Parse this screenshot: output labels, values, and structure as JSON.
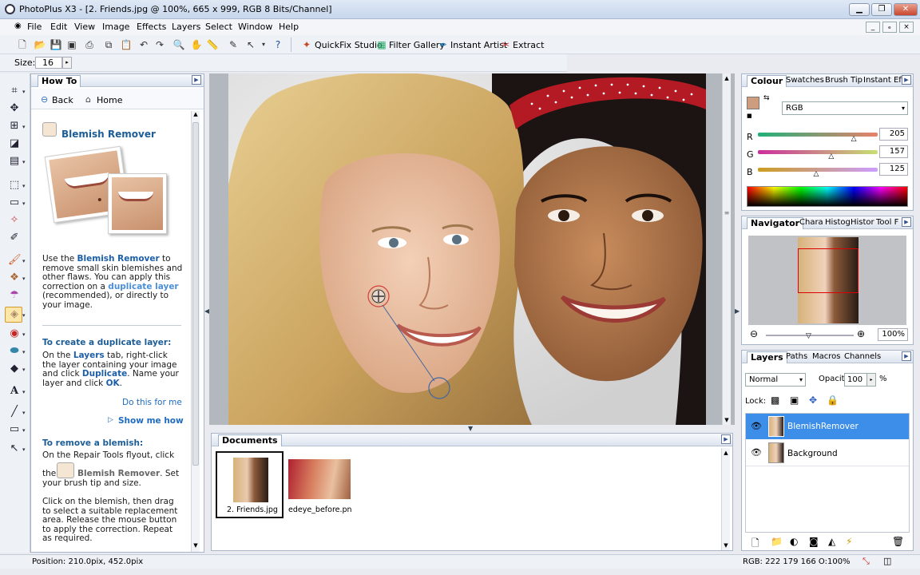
{
  "window": {
    "title": "PhotoPlus X3 - [2. Friends.jpg @ 100%, 665 x 999, RGB 8 Bits/Channel]",
    "controls": [
      "minimize",
      "maximize",
      "close"
    ],
    "mdi_controls": [
      "_",
      "ₑ",
      "×"
    ]
  },
  "menu": [
    "File",
    "Edit",
    "View",
    "Image",
    "Effects",
    "Layers",
    "Select",
    "Window",
    "Help"
  ],
  "toolbar": {
    "quickfix": "QuickFix Studio",
    "filter_gallery": "Filter Gallery",
    "instant_artist": "Instant Artist",
    "extract": "Extract"
  },
  "context": {
    "size_label": "Size:",
    "size_value": "16"
  },
  "howto": {
    "tab": "How To",
    "back": "Back",
    "home": "Home",
    "title": "Blemish Remover",
    "intro_pre": "Use the ",
    "intro_tool": "Blemish Remover",
    "intro_mid": " to remove small skin blemishes and other flaws. You can apply this correction on a ",
    "intro_link": "duplicate layer",
    "intro_post": " (recommended), or directly to your image.",
    "section1": "To create a duplicate layer:",
    "s1_pre": "On the ",
    "s1_layers": "Layers",
    "s1_mid": " tab, right-click the layer containing your image and click ",
    "s1_dup": "Duplicate",
    "s1_mid2": ". Name your layer and click ",
    "s1_ok": "OK",
    "s1_end": ".",
    "do_this": "Do this for me",
    "show_me": "Show me how",
    "section2": "To remove a blemish:",
    "s2_line1": "On the Repair Tools flyout, click",
    "s2_the": "the",
    "s2_tool": "Blemish Remover",
    "s2_rest": ". Set your brush tip and size.",
    "s2_para2": "Click on the blemish, then drag to select a suitable replacement area. Release the mouse button to apply the correction. Repeat as required."
  },
  "documents": {
    "tab": "Documents",
    "items": [
      "2. Friends.jpg",
      "edeye_before.png"
    ]
  },
  "colour": {
    "tabs": [
      "Colour",
      "Swatches",
      "Brush Tip",
      "Instant Eff"
    ],
    "mode": "RGB",
    "r_label": "R",
    "g_label": "G",
    "b_label": "B",
    "r": "205",
    "g": "157",
    "b": "125",
    "swatch": "#cd9d7d"
  },
  "navigator": {
    "tabs": [
      "Navigator",
      "Chara",
      "Histog",
      "Histor",
      "Tool F"
    ],
    "zoom": "100%"
  },
  "layers": {
    "tabs": [
      "Layers",
      "Paths",
      "Macros",
      "Channels"
    ],
    "blend": "Normal",
    "opacity_label": "Opacity:",
    "opacity": "100",
    "percent": "%",
    "lock_label": "Lock:",
    "items": [
      "BlemishRemover",
      "Background"
    ],
    "selected_color": "#3d8ee8"
  },
  "status": {
    "position": "Position: 210.0pix, 452.0pix",
    "rgb": "RGB: 222 179 166 O:100%"
  }
}
